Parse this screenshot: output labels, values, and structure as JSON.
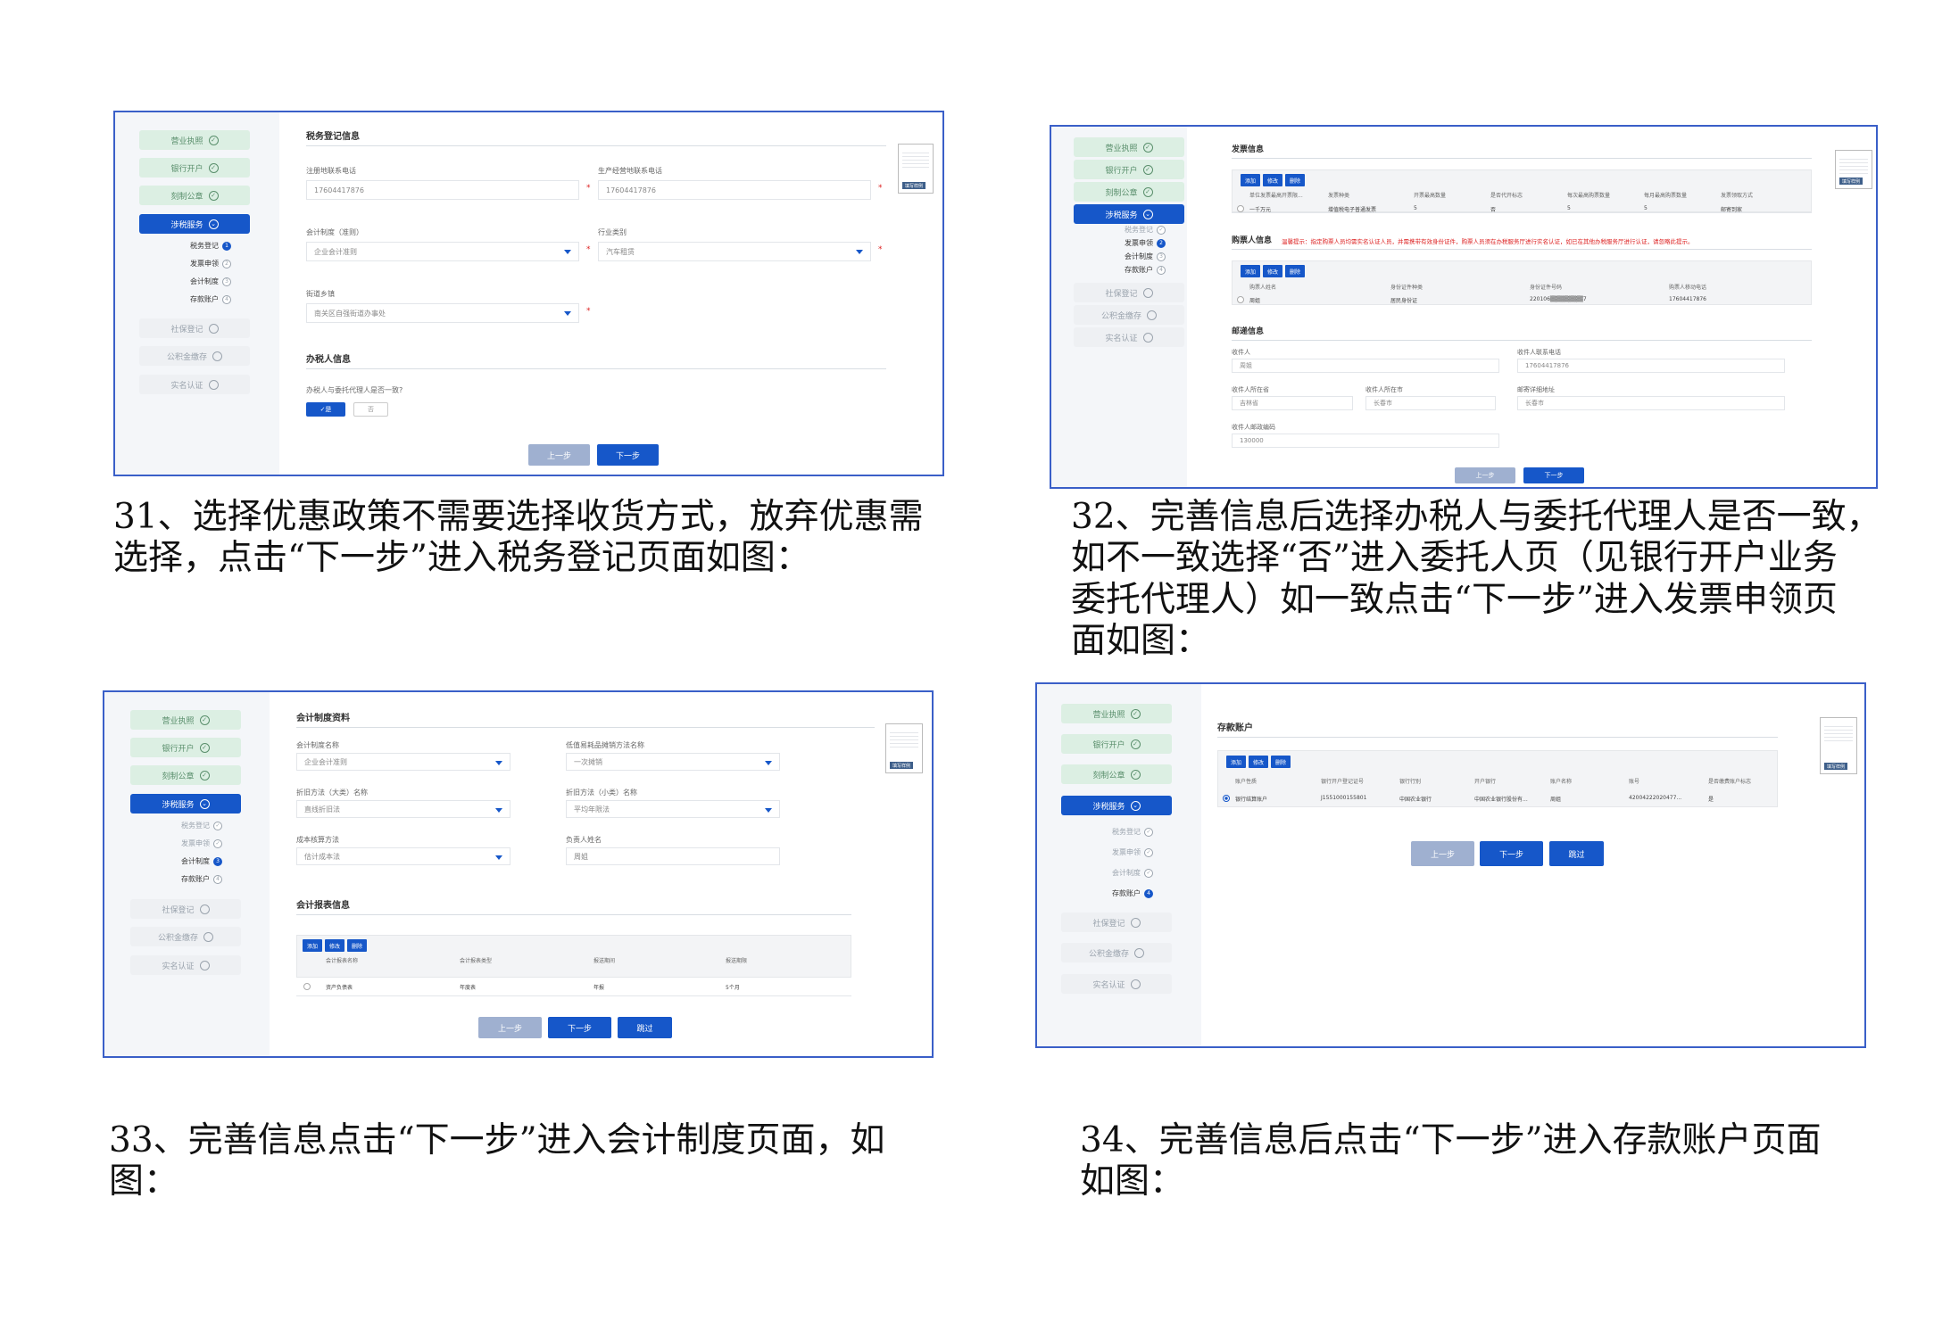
{
  "captions": {
    "c31": [
      "31、选择优惠政策不需要选择收货方式，放弃优惠需",
      "选择，点击“下一步”进入税务登记页面如图："
    ],
    "c32": [
      "32、完善信息后选择办税人与委托代理人是否一致，",
      "如不一致选择“否”进入委托人页（见银行开户业务",
      "委托代理人）如一致点击“下一步”进入发票申领页",
      "面如图："
    ],
    "c33": [
      "33、完善信息点击“下一步”进入会计制度页面，如",
      "图："
    ],
    "c34": [
      "34、完善信息后点击“下一步”进入存款账户页面",
      "如图："
    ]
  },
  "nav": {
    "yyzz": "营业执照",
    "yhkh": "银行开户",
    "kzgz": "刻制公章",
    "sswf": "涉税服务",
    "sbdj": "社保登记",
    "gjjjc": "公积金缴存",
    "smrz": "实名认证",
    "sub": [
      "税务登记",
      "发票申领",
      "会计制度",
      "存款账户"
    ]
  },
  "buttons": {
    "prev": "上一步",
    "next": "下一步",
    "skip": "跳过",
    "add": "添加",
    "edit": "修改",
    "del": "删除",
    "thumb": "填写样例"
  },
  "s1": {
    "section1": "税务登记信息",
    "reg_phone_label": "注册地联系电话",
    "reg_phone": "17604417876",
    "biz_phone_label": "生产经营地联系电话",
    "biz_phone": "17604417876",
    "acct_label": "会计制度（准则）",
    "acct": "企业会计准则",
    "industry_label": "行业类别",
    "industry": "汽车租赁",
    "street_label": "街道乡镇",
    "street": "南关区自强街道办事处",
    "section2": "办税人信息",
    "same_q": "办税人与委托代理人是否一致?",
    "yes": "✓是",
    "no": "否"
  },
  "s2": {
    "section1": "发票信息",
    "inv_headers": [
      "单位发票最高开票限...",
      "发票种类",
      "开票最高数量",
      "是否代开标志",
      "每次最高购票数量",
      "每月最高购票数量",
      "发票领取方式"
    ],
    "inv_row": [
      "一千万元",
      "增值税电子普通发票",
      "5",
      "否",
      "5",
      "5",
      "邮寄到家"
    ],
    "section2": "购票人信息",
    "warning": "温馨提示：指定购票人员均需实名认证人员，并需携带有效身份证件，购票人员须在办税服务厅进行实名认证，如已在其他办税服务厅进行认证，请忽略此提示。",
    "buyer_headers": [
      "购票人姓名",
      "身份证件种类",
      "身份证件号码",
      "购票人移动电话"
    ],
    "buyer_row": [
      "周姐",
      "居民身份证",
      "220106▒▒▒▒▒▒▒▒7",
      "17604417876"
    ],
    "section3": "邮递信息",
    "recv_label": "收件人",
    "recv": "周姐",
    "recv_phone_label": "收件人联系电话",
    "recv_phone": "17604417876",
    "prov_label": "收件人所在省",
    "prov": "吉林省",
    "city_label": "收件人所在市",
    "city": "长春市",
    "addr_label": "邮寄详细地址",
    "addr": "长春市",
    "zip_label": "收件人邮政编码",
    "zip": "130000"
  },
  "s3": {
    "section1": "会计制度资料",
    "acct_label": "会计制度名称",
    "acct": "企业会计准则",
    "lowval_label": "低值易耗品摊销方法名称",
    "lowval": "一次摊销",
    "depbig_label": "折旧方法（大类）名称",
    "depbig": "直线折旧法",
    "depsmall_label": "折旧方法（小类）名称",
    "depsmall": "平均年限法",
    "cost_label": "成本核算方法",
    "cost": "估计成本法",
    "person_label": "负责人姓名",
    "person": "周姐",
    "section2": "会计报表信息",
    "headers": [
      "会计报表名称",
      "会计报表类型",
      "报送期间",
      "报送期限"
    ],
    "row": [
      "资产负债表",
      "年度表",
      "年报",
      "5个月"
    ]
  },
  "s4": {
    "section1": "存款账户",
    "headers": [
      "账户性质",
      "银行开户登记证号",
      "银行行别",
      "开户银行",
      "账户名称",
      "账号",
      "是否缴费账户标志"
    ],
    "row": [
      "银行结算账户",
      "J1551000155801",
      "中国农业银行",
      "中国农业银行股份有...",
      "周姐",
      "42004222020477...",
      "是"
    ]
  }
}
